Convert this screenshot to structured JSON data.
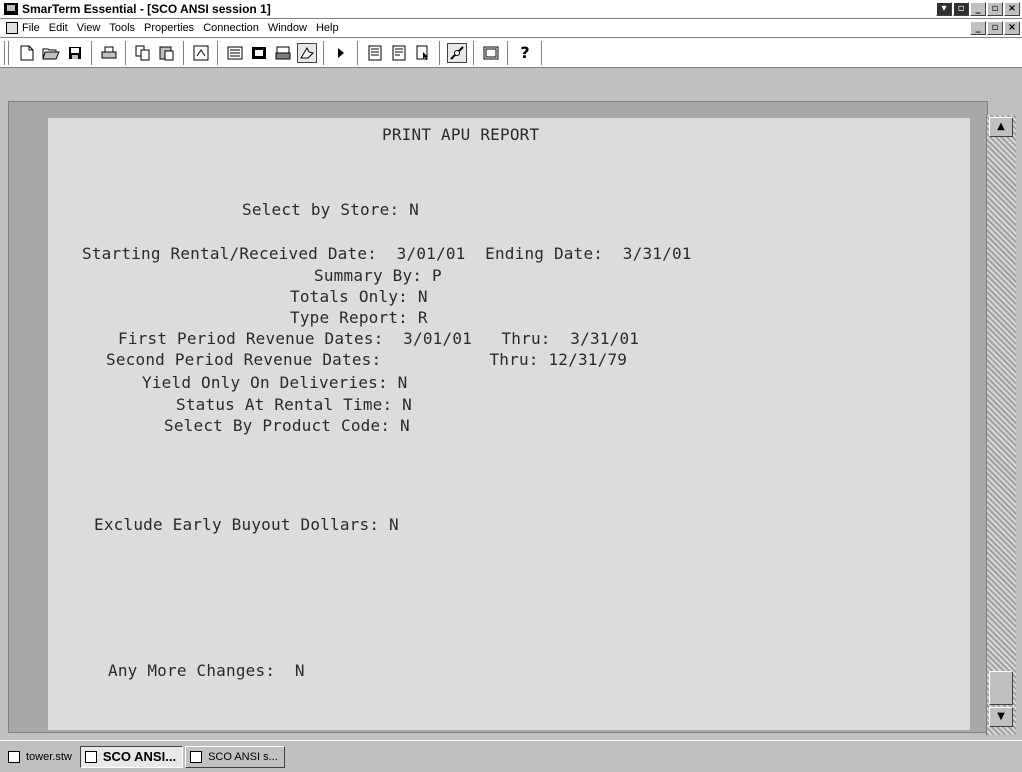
{
  "window": {
    "title": "SmarTerm Essential - [SCO ANSI session 1]",
    "controls": [
      "_",
      "▫",
      "×"
    ]
  },
  "menu": {
    "items": [
      {
        "label": "File"
      },
      {
        "label": "Edit"
      },
      {
        "label": "View"
      },
      {
        "label": "Tools"
      },
      {
        "label": "Properties"
      },
      {
        "label": "Connection"
      },
      {
        "label": "Window"
      },
      {
        "label": "Help"
      }
    ]
  },
  "toolbar": {
    "icons": [
      "new-icon",
      "open-icon",
      "save-icon",
      "print-icon",
      "copy-icon",
      "paste-icon",
      "properties-icon",
      "hotspot-icon",
      "terminal-icon",
      "macro-icon",
      "cursor-icon",
      "play-icon",
      "capture-start-icon",
      "capture-stop-icon",
      "select-icon",
      "connect-icon",
      "screen-icon",
      "help-icon"
    ],
    "help_glyph": "?"
  },
  "terminal": {
    "lines": [
      {
        "text": "PRINT APU REPORT"
      },
      {
        "text": "Select by Store: N"
      },
      {
        "text": "Starting Rental/Received Date:  3/01/01  Ending Date:  3/31/01"
      },
      {
        "text": "Summary By: P"
      },
      {
        "text": "Totals Only: N"
      },
      {
        "text": "Type Report: R"
      },
      {
        "text": "First Period Revenue Dates:  3/01/01   Thru:  3/31/01"
      },
      {
        "text": "Second Period Revenue Dates:           Thru: 12/31/79"
      },
      {
        "text": "Yield Only On Deliveries: N"
      },
      {
        "text": "Status At Rental Time: N"
      },
      {
        "text": "Select By Product Code: N"
      },
      {
        "text": "Exclude Early Buyout Dollars: N"
      },
      {
        "text": "Any More Changes:  N"
      }
    ]
  },
  "taskbar": {
    "items": [
      {
        "label": "tower.stw"
      },
      {
        "label": "SCO ANSI..."
      },
      {
        "label": "SCO ANSI s..."
      }
    ]
  }
}
